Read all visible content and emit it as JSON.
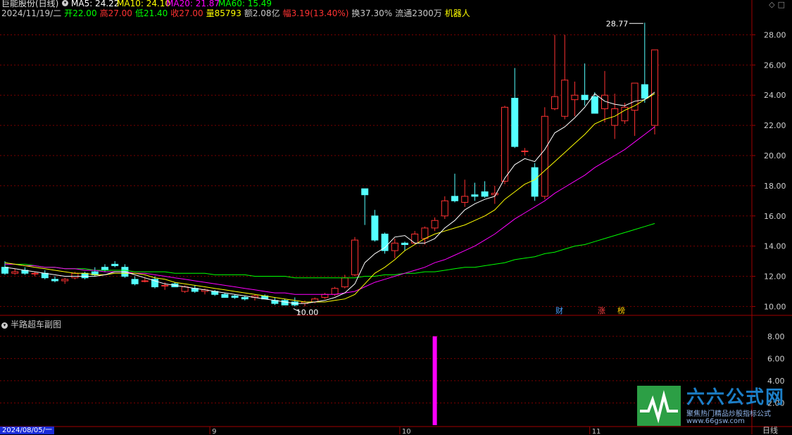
{
  "header": {
    "title": "巨能股份(日线)",
    "ma": [
      {
        "label": "MA5: 24.22",
        "color": "#ffffff"
      },
      {
        "label": "MA10: 24.10",
        "color": "#ffff00"
      },
      {
        "label": "MA20: 21.87",
        "color": "#ff00ff"
      },
      {
        "label": "MA60: 15.49",
        "color": "#00ff00"
      }
    ]
  },
  "info": {
    "date": "2024/11/19/二",
    "open": "开22.00",
    "high": "高27.00",
    "low": "低21.40",
    "close": "收27.00",
    "volume": "量85793",
    "amount": "额2.08亿",
    "change": "幅3.19(13.40%)",
    "turnover": "换37.30%",
    "float": "流通2300万",
    "tag": "机器人"
  },
  "price_axis": {
    "ticks": [
      28.0,
      26.0,
      24.0,
      22.0,
      20.0,
      18.0,
      16.0,
      14.0,
      12.0,
      10.0
    ],
    "tick_labels": [
      "28.00",
      "26.00",
      "24.00",
      "22.00",
      "20.00",
      "18.00",
      "16.00",
      "14.00",
      "12.00",
      "10.00"
    ],
    "max_label": "28.77",
    "min_label": "10.00"
  },
  "sub_chart": {
    "title": "半路超车副图",
    "ticks": [
      8,
      6,
      4,
      2
    ],
    "tick_labels": [
      "8.00",
      "6.00",
      "4.00",
      "2.00"
    ],
    "bar": {
      "index": 43,
      "value": 8.0,
      "color": "#ff00ff"
    }
  },
  "flags": [
    {
      "label": "财",
      "color": "#4aa0ff"
    },
    {
      "label": "涨",
      "color": "#ff4040"
    },
    {
      "label": "榜",
      "color": "#ffcc00"
    }
  ],
  "date_axis": {
    "cursor_date": "2024/08/05/一",
    "month_labels": [
      "9",
      "10",
      "11"
    ],
    "period": "日线"
  },
  "brand": {
    "name": "六六公式网",
    "slogan": "聚焦热门精品炒股指标公式",
    "url": "www.66gsw.com"
  },
  "colors": {
    "up": "#ff3232",
    "down": "#54ffff",
    "ma5": "#ffffff",
    "ma10": "#ffff00",
    "ma20": "#ff00ff",
    "ma60": "#00ff00",
    "grid": "#7a0000"
  },
  "chart_data": {
    "type": "candlestick",
    "candles": [
      {
        "o": 12.6,
        "h": 13.0,
        "l": 12.1,
        "c": 12.2
      },
      {
        "o": 12.2,
        "h": 12.5,
        "l": 12.1,
        "c": 12.3
      },
      {
        "o": 12.4,
        "h": 12.6,
        "l": 12.1,
        "c": 12.2
      },
      {
        "o": 12.2,
        "h": 12.3,
        "l": 12.0,
        "c": 12.2
      },
      {
        "o": 12.2,
        "h": 12.4,
        "l": 11.8,
        "c": 11.9
      },
      {
        "o": 11.8,
        "h": 12.0,
        "l": 11.6,
        "c": 11.7
      },
      {
        "o": 11.7,
        "h": 11.9,
        "l": 11.5,
        "c": 11.8
      },
      {
        "o": 11.9,
        "h": 12.3,
        "l": 11.8,
        "c": 12.2
      },
      {
        "o": 12.2,
        "h": 12.3,
        "l": 11.8,
        "c": 11.9
      },
      {
        "o": 12.3,
        "h": 12.6,
        "l": 12.0,
        "c": 12.1
      },
      {
        "o": 12.6,
        "h": 12.8,
        "l": 12.3,
        "c": 12.4
      },
      {
        "o": 12.8,
        "h": 13.0,
        "l": 12.6,
        "c": 12.7
      },
      {
        "o": 12.6,
        "h": 12.8,
        "l": 11.9,
        "c": 12.0
      },
      {
        "o": 11.8,
        "h": 12.0,
        "l": 11.4,
        "c": 11.5
      },
      {
        "o": 11.7,
        "h": 11.9,
        "l": 11.6,
        "c": 11.7
      },
      {
        "o": 11.8,
        "h": 12.0,
        "l": 11.2,
        "c": 11.3
      },
      {
        "o": 11.4,
        "h": 11.6,
        "l": 11.1,
        "c": 11.4
      },
      {
        "o": 11.5,
        "h": 11.6,
        "l": 11.3,
        "c": 11.3
      },
      {
        "o": 11.0,
        "h": 11.4,
        "l": 10.9,
        "c": 11.3
      },
      {
        "o": 11.2,
        "h": 11.4,
        "l": 10.9,
        "c": 11.0
      },
      {
        "o": 11.0,
        "h": 11.2,
        "l": 10.8,
        "c": 11.1
      },
      {
        "o": 11.0,
        "h": 11.1,
        "l": 10.7,
        "c": 10.8
      },
      {
        "o": 10.8,
        "h": 10.9,
        "l": 10.6,
        "c": 10.6
      },
      {
        "o": 10.7,
        "h": 10.8,
        "l": 10.5,
        "c": 10.6
      },
      {
        "o": 10.6,
        "h": 10.7,
        "l": 10.4,
        "c": 10.5
      },
      {
        "o": 10.6,
        "h": 10.8,
        "l": 10.4,
        "c": 10.7
      },
      {
        "o": 10.7,
        "h": 10.8,
        "l": 10.5,
        "c": 10.5
      },
      {
        "o": 10.4,
        "h": 10.6,
        "l": 10.1,
        "c": 10.2
      },
      {
        "o": 10.4,
        "h": 10.5,
        "l": 10.1,
        "c": 10.1
      },
      {
        "o": 10.3,
        "h": 10.6,
        "l": 10.0,
        "c": 10.1
      },
      {
        "o": 10.2,
        "h": 10.4,
        "l": 10.0,
        "c": 10.3
      },
      {
        "o": 10.3,
        "h": 10.6,
        "l": 10.2,
        "c": 10.5
      },
      {
        "o": 10.6,
        "h": 10.9,
        "l": 10.5,
        "c": 10.8
      },
      {
        "o": 10.8,
        "h": 11.3,
        "l": 10.7,
        "c": 11.2
      },
      {
        "o": 11.3,
        "h": 12.1,
        "l": 11.2,
        "c": 11.9
      },
      {
        "o": 12.1,
        "h": 14.6,
        "l": 12.0,
        "c": 14.4
      },
      {
        "o": 17.8,
        "h": 17.8,
        "l": 15.4,
        "c": 17.4
      },
      {
        "o": 16.0,
        "h": 16.4,
        "l": 14.3,
        "c": 14.4
      },
      {
        "o": 14.8,
        "h": 14.9,
        "l": 13.5,
        "c": 13.7
      },
      {
        "o": 13.7,
        "h": 14.5,
        "l": 13.2,
        "c": 14.2
      },
      {
        "o": 14.2,
        "h": 14.3,
        "l": 13.7,
        "c": 14.1
      },
      {
        "o": 14.2,
        "h": 15.0,
        "l": 14.1,
        "c": 14.8
      },
      {
        "o": 14.5,
        "h": 15.3,
        "l": 14.1,
        "c": 15.2
      },
      {
        "o": 15.2,
        "h": 15.9,
        "l": 15.0,
        "c": 15.7
      },
      {
        "o": 16.0,
        "h": 17.3,
        "l": 15.8,
        "c": 17.0
      },
      {
        "o": 17.3,
        "h": 18.8,
        "l": 16.9,
        "c": 17.0
      },
      {
        "o": 16.9,
        "h": 18.4,
        "l": 16.6,
        "c": 17.3
      },
      {
        "o": 17.4,
        "h": 18.2,
        "l": 17.0,
        "c": 17.3
      },
      {
        "o": 17.6,
        "h": 18.3,
        "l": 17.2,
        "c": 17.3
      },
      {
        "o": 17.4,
        "h": 18.0,
        "l": 16.8,
        "c": 17.5
      },
      {
        "o": 18.3,
        "h": 23.3,
        "l": 18.1,
        "c": 23.2
      },
      {
        "o": 23.8,
        "h": 25.8,
        "l": 20.5,
        "c": 20.6
      },
      {
        "o": 20.3,
        "h": 20.5,
        "l": 20.0,
        "c": 20.3
      },
      {
        "o": 19.2,
        "h": 19.5,
        "l": 17.0,
        "c": 17.3
      },
      {
        "o": 17.3,
        "h": 23.2,
        "l": 17.1,
        "c": 22.6
      },
      {
        "o": 23.1,
        "h": 28.0,
        "l": 23.0,
        "c": 23.9
      },
      {
        "o": 22.6,
        "h": 28.0,
        "l": 22.4,
        "c": 25.0
      },
      {
        "o": 23.7,
        "h": 24.9,
        "l": 22.6,
        "c": 24.0
      },
      {
        "o": 24.0,
        "h": 26.1,
        "l": 23.3,
        "c": 23.7
      },
      {
        "o": 23.9,
        "h": 24.2,
        "l": 22.8,
        "c": 22.8
      },
      {
        "o": 23.1,
        "h": 25.6,
        "l": 22.2,
        "c": 24.0
      },
      {
        "o": 22.0,
        "h": 24.1,
        "l": 21.1,
        "c": 23.1
      },
      {
        "o": 22.3,
        "h": 23.5,
        "l": 22.1,
        "c": 23.2
      },
      {
        "o": 23.0,
        "h": 24.8,
        "l": 21.3,
        "c": 24.8
      },
      {
        "o": 24.7,
        "h": 28.8,
        "l": 23.5,
        "c": 23.8
      },
      {
        "o": 22.0,
        "h": 27.0,
        "l": 21.4,
        "c": 27.0
      }
    ],
    "ma5": [
      12.6,
      12.5,
      12.4,
      12.3,
      12.2,
      12.1,
      12.0,
      12.0,
      12.0,
      12.0,
      12.1,
      12.3,
      12.3,
      12.1,
      11.9,
      11.7,
      11.5,
      11.4,
      11.3,
      11.2,
      11.1,
      11.0,
      10.9,
      10.8,
      10.7,
      10.6,
      10.5,
      10.4,
      10.3,
      10.2,
      10.2,
      10.3,
      10.4,
      10.6,
      10.9,
      11.5,
      12.9,
      13.5,
      13.9,
      14.6,
      14.7,
      14.2,
      14.2,
      14.5,
      15.2,
      15.7,
      16.4,
      16.8,
      17.1,
      17.3,
      18.5,
      19.4,
      19.8,
      19.6,
      20.4,
      21.5,
      21.9,
      22.5,
      23.2,
      24.1,
      23.6,
      23.4,
      23.3,
      23.6,
      23.7,
      24.2
    ],
    "ma10": [
      12.9,
      12.8,
      12.7,
      12.6,
      12.5,
      12.4,
      12.3,
      12.2,
      12.2,
      12.1,
      12.1,
      12.2,
      12.2,
      12.2,
      12.1,
      11.9,
      11.8,
      11.6,
      11.5,
      11.4,
      11.3,
      11.2,
      11.1,
      11.0,
      10.9,
      10.8,
      10.7,
      10.6,
      10.5,
      10.4,
      10.3,
      10.3,
      10.3,
      10.4,
      10.5,
      10.8,
      11.5,
      12.2,
      12.6,
      13.1,
      13.7,
      14.1,
      14.5,
      14.8,
      15.0,
      15.2,
      15.4,
      15.7,
      16.0,
      16.4,
      17.1,
      17.6,
      18.1,
      18.4,
      19.0,
      19.6,
      20.2,
      20.8,
      21.4,
      22.1,
      22.4,
      22.6,
      23.0,
      23.3,
      23.7,
      24.1
    ],
    "ma20": [
      12.8,
      12.8,
      12.7,
      12.7,
      12.6,
      12.6,
      12.5,
      12.5,
      12.4,
      12.4,
      12.3,
      12.3,
      12.3,
      12.2,
      12.2,
      12.1,
      12.0,
      11.9,
      11.8,
      11.7,
      11.6,
      11.5,
      11.4,
      11.3,
      11.2,
      11.1,
      11.0,
      10.9,
      10.9,
      10.8,
      10.8,
      10.8,
      10.8,
      10.8,
      10.9,
      11.0,
      11.3,
      11.6,
      11.8,
      12.0,
      12.2,
      12.4,
      12.6,
      12.9,
      13.1,
      13.4,
      13.7,
      14.0,
      14.4,
      14.8,
      15.3,
      15.8,
      16.2,
      16.6,
      17.0,
      17.5,
      17.9,
      18.3,
      18.7,
      19.2,
      19.6,
      20.0,
      20.4,
      20.9,
      21.4,
      21.9
    ],
    "ma60": [
      12.9,
      12.8,
      12.8,
      12.7,
      12.6,
      12.6,
      12.5,
      12.5,
      12.5,
      12.4,
      12.4,
      12.4,
      12.4,
      12.3,
      12.3,
      12.3,
      12.3,
      12.2,
      12.2,
      12.2,
      12.2,
      12.1,
      12.1,
      12.1,
      12.1,
      12.0,
      12.0,
      12.0,
      12.0,
      11.9,
      11.9,
      11.9,
      11.9,
      11.9,
      11.9,
      11.9,
      12.0,
      12.0,
      12.1,
      12.1,
      12.2,
      12.2,
      12.3,
      12.3,
      12.4,
      12.5,
      12.6,
      12.6,
      12.7,
      12.8,
      12.9,
      13.1,
      13.2,
      13.3,
      13.5,
      13.6,
      13.8,
      14.0,
      14.1,
      14.3,
      14.5,
      14.7,
      14.9,
      15.1,
      15.3,
      15.5
    ],
    "y_range": [
      9.6,
      29.0
    ],
    "sub_y_range": [
      0,
      9
    ]
  }
}
